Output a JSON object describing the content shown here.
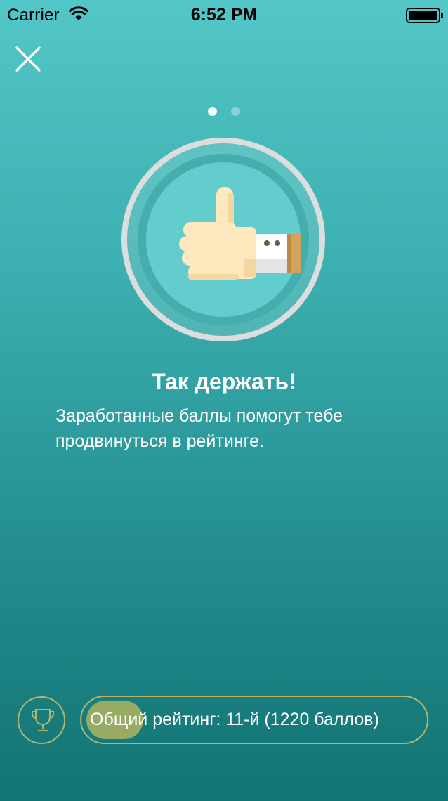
{
  "status_bar": {
    "carrier": "Carrier",
    "time": "6:52 PM",
    "wifi_icon": "wifi-icon",
    "battery_icon": "battery-full-icon"
  },
  "close_icon": "close-icon",
  "pager": {
    "count": 2,
    "active_index": 0
  },
  "illustration": "thumbs-up-icon",
  "content": {
    "title": "Так держать!",
    "description": "Заработанные баллы помогут тебе продвинуться в рейтинге."
  },
  "rating": {
    "trophy_icon": "trophy-icon",
    "label": "Общий рейтинг: 11-й (1220 баллов)",
    "progress_fraction": 0.17
  },
  "colors": {
    "gradient_top": "#53c6c7",
    "gradient_bottom": "#127374",
    "accent_outline": "#b6b56a",
    "progress_fill": "#97ab62"
  }
}
